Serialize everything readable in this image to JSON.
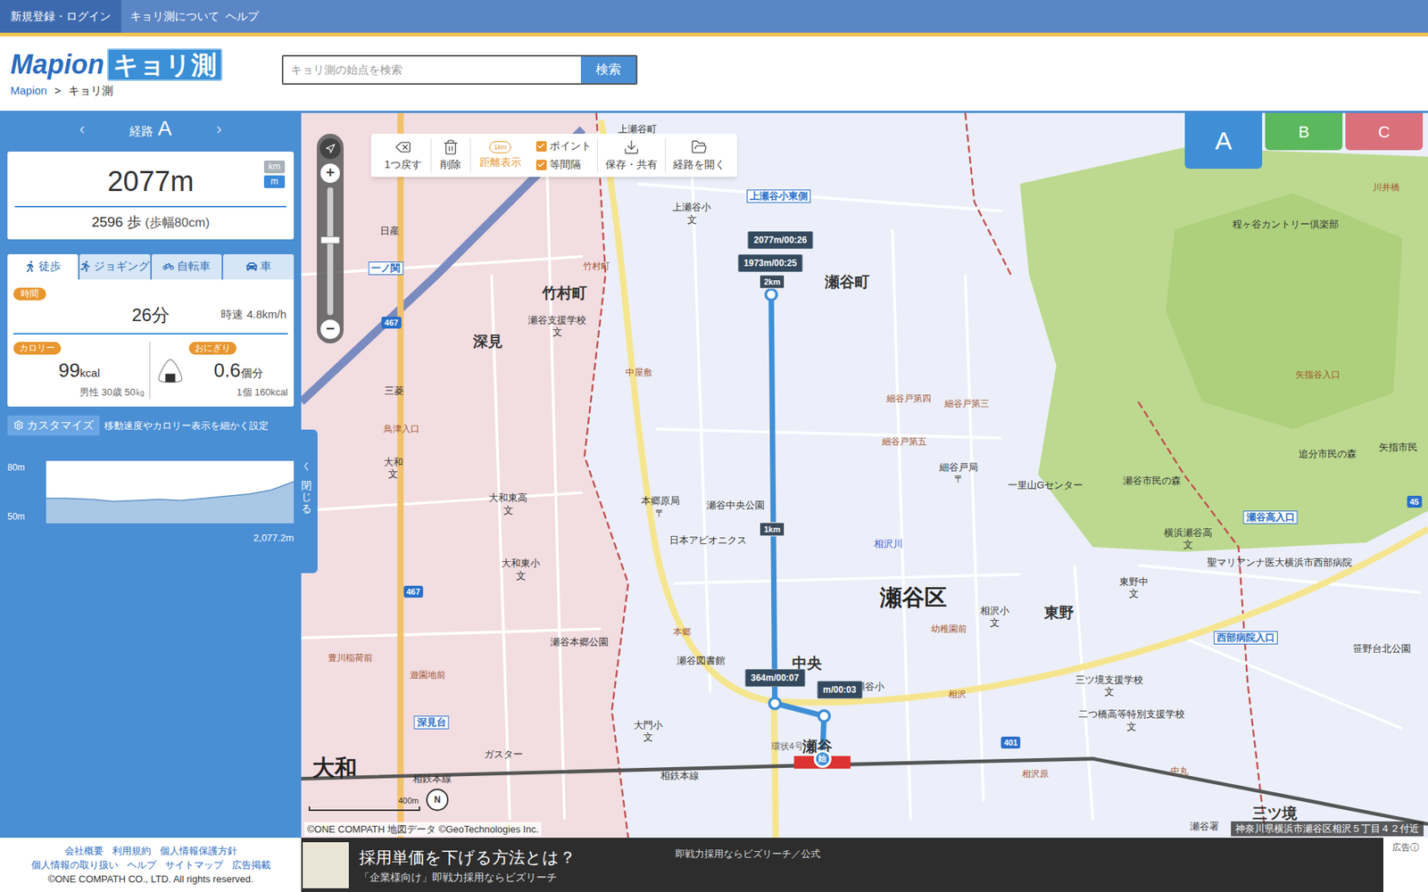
{
  "topbar": {
    "links": [
      {
        "label": "新規登録・ログイン",
        "selected": true
      },
      {
        "label": "キョリ測について",
        "selected": false
      },
      {
        "label": "ヘルプ",
        "selected": false
      }
    ]
  },
  "header": {
    "logo": {
      "brand": "Mapion",
      "product": "キョリ測"
    },
    "breadcrumb": [
      "Mapion",
      ">",
      "キョリ測"
    ],
    "search": {
      "placeholder": "キョリ測の始点を検索",
      "button": "検索"
    }
  },
  "sidebar": {
    "route": {
      "prev": "‹",
      "label": "経路",
      "name": "A",
      "next": "›"
    },
    "distance": {
      "value": "2077m",
      "units": [
        {
          "label": "km",
          "selected": false
        },
        {
          "label": "m",
          "selected": true
        }
      ],
      "steps": "2596 歩",
      "stride": "(歩幅80cm)"
    },
    "modes": [
      {
        "label": "徒歩",
        "selected": true
      },
      {
        "label": "ジョギング",
        "selected": false
      },
      {
        "label": "自転車",
        "selected": false
      },
      {
        "label": "車",
        "selected": false
      }
    ],
    "time": {
      "badge": "時間",
      "value": "26分",
      "speed": "時速 4.8km/h"
    },
    "calorie": {
      "badge": "カロリー",
      "value": "99",
      "unit": "kcal",
      "note": "男性 30歳 50㎏"
    },
    "onigiri": {
      "badge": "おにぎり",
      "value": "0.6",
      "unit": "個分",
      "note": "1個 160kcal"
    },
    "customize": {
      "button": "カスタマイズ",
      "note": "移動速度やカロリー表示を細かく設定"
    },
    "elevation": {
      "ticks": [
        "80m",
        "50m"
      ],
      "min": 50,
      "max": 80,
      "values": [
        62,
        62,
        61.5,
        60.5,
        61,
        61.5,
        61,
        62,
        63,
        64,
        66,
        70
      ],
      "distance": "2,077.2m"
    },
    "collapse": {
      "arrow": "く",
      "label": "閉じる"
    }
  },
  "map": {
    "toolbar": {
      "actions": [
        {
          "label": "1つ戻す"
        },
        {
          "label": "削除"
        }
      ],
      "distance": {
        "label": "距離表示",
        "badge": "1km",
        "active": true
      },
      "options": [
        {
          "label": "ポイント",
          "checked": true
        },
        {
          "label": "等間隔",
          "checked": true
        }
      ],
      "files": [
        {
          "label": "保存・共有"
        },
        {
          "label": "経路を開く"
        }
      ]
    },
    "routes": [
      {
        "label": "A",
        "selected": true,
        "color": "#3f8fd6"
      },
      {
        "label": "B",
        "selected": false,
        "color": "#5cb85c"
      },
      {
        "label": "C",
        "selected": false,
        "color": "#d9707a"
      }
    ],
    "zoom": {
      "in": "+",
      "out": "−",
      "level": 0.59
    },
    "markers": [
      {
        "text": "2077m/00:26",
        "kind": "label"
      },
      {
        "text": "1973m/00:25",
        "kind": "label"
      },
      {
        "text": "2km",
        "kind": "tick"
      },
      {
        "text": "1km",
        "kind": "tick"
      },
      {
        "text": "364m/00:07",
        "kind": "label"
      },
      {
        "text": "m/00:03",
        "kind": "label"
      },
      {
        "text": "始",
        "kind": "start"
      }
    ],
    "labels": [
      {
        "text": "上瀬谷町",
        "kind": "place"
      },
      {
        "text": "上瀬谷小東側",
        "kind": "bus"
      },
      {
        "text": "上瀬谷小",
        "kind": "facility",
        "symbol": "文"
      },
      {
        "text": "竹村町",
        "kind": "district"
      },
      {
        "text": "瀬谷町",
        "kind": "district"
      },
      {
        "text": "深見",
        "kind": "district"
      },
      {
        "text": "瀬谷支援学校",
        "kind": "facility",
        "symbol": "文"
      },
      {
        "text": "竹村町",
        "kind": "road"
      },
      {
        "text": "中屋敷",
        "kind": "road"
      },
      {
        "text": "一ノ関",
        "kind": "bus"
      },
      {
        "text": "日産",
        "kind": "place"
      },
      {
        "text": "三菱",
        "kind": "place"
      },
      {
        "text": "鳥津入口",
        "kind": "road"
      },
      {
        "text": "大和",
        "kind": "facility",
        "symbol": "文"
      },
      {
        "text": "大和東高",
        "kind": "facility",
        "symbol": "文"
      },
      {
        "text": "本郷原局",
        "kind": "facility",
        "symbol": "〒"
      },
      {
        "text": "瀬谷中央公園",
        "kind": "facility"
      },
      {
        "text": "日本アビオニクス",
        "kind": "facility"
      },
      {
        "text": "大和東小",
        "kind": "facility",
        "symbol": "文"
      },
      {
        "text": "細谷戸第四",
        "kind": "road"
      },
      {
        "text": "細谷戸第三",
        "kind": "road"
      },
      {
        "text": "細谷戸第五",
        "kind": "road"
      },
      {
        "text": "細谷戸局",
        "kind": "facility",
        "symbol": "〒"
      },
      {
        "text": "一里山Gセンター",
        "kind": "facility"
      },
      {
        "text": "相沢川",
        "kind": "river"
      },
      {
        "text": "瀬谷区",
        "kind": "city"
      },
      {
        "text": "相沢小",
        "kind": "facility",
        "symbol": "文"
      },
      {
        "text": "東野",
        "kind": "district"
      },
      {
        "text": "東野中",
        "kind": "facility",
        "symbol": "文"
      },
      {
        "text": "横浜瀬谷高",
        "kind": "facility",
        "symbol": "文"
      },
      {
        "text": "聖マリアンナ医大横浜市西部病院",
        "kind": "facility"
      },
      {
        "text": "瀬谷市民の森",
        "kind": "facility"
      },
      {
        "text": "追分市民の森",
        "kind": "facility"
      },
      {
        "text": "矢指市民",
        "kind": "facility"
      },
      {
        "text": "瀬谷高入口",
        "kind": "bus"
      },
      {
        "text": "程ヶ谷カントリー倶楽部",
        "kind": "facility"
      },
      {
        "text": "矢指谷入口",
        "kind": "road"
      },
      {
        "text": "西部病院入口",
        "kind": "bus"
      },
      {
        "text": "笹野台北公園",
        "kind": "facility"
      },
      {
        "text": "三ツ境支援学校",
        "kind": "facility",
        "symbol": "文"
      },
      {
        "text": "二つ橋高等特別支援学校",
        "kind": "facility",
        "symbol": "文"
      },
      {
        "text": "中央",
        "kind": "district"
      },
      {
        "text": "瀬谷小",
        "kind": "facility"
      },
      {
        "text": "幼稚園前",
        "kind": "road"
      },
      {
        "text": "瀬谷図書館",
        "kind": "facility"
      },
      {
        "text": "瀬谷本郷公園",
        "kind": "facility"
      },
      {
        "text": "大門小",
        "kind": "facility",
        "symbol": "文"
      },
      {
        "text": "深見台",
        "kind": "bus"
      },
      {
        "text": "大和",
        "kind": "city"
      },
      {
        "text": "ガスター",
        "kind": "facility"
      },
      {
        "text": "相鉄本線",
        "kind": "place"
      },
      {
        "text": "相鉄本線",
        "kind": "place"
      },
      {
        "text": "瀬谷",
        "kind": "district"
      },
      {
        "text": "環状4号",
        "kind": "vertical"
      },
      {
        "text": "三ツ境",
        "kind": "district"
      },
      {
        "text": "瀬谷署",
        "kind": "place"
      },
      {
        "text": "中丸",
        "kind": "road"
      },
      {
        "text": "相沢原",
        "kind": "road"
      },
      {
        "text": "相沢",
        "kind": "road"
      },
      {
        "text": "401",
        "kind": "route"
      },
      {
        "text": "467",
        "kind": "route"
      },
      {
        "text": "467",
        "kind": "route"
      },
      {
        "text": "45",
        "kind": "route"
      },
      {
        "text": "川井橋",
        "kind": "road"
      },
      {
        "text": "本郷",
        "kind": "road"
      },
      {
        "text": "豊川稲荷前",
        "kind": "road"
      },
      {
        "text": "遊園地前",
        "kind": "road"
      }
    ],
    "scale": "400m",
    "compass": "N",
    "copyright": "©ONE COMPATH 地図データ ©GeoTechnologies Inc.",
    "address": "神奈川県横浜市瀬谷区相沢５丁目４２付近"
  },
  "footer": {
    "links": [
      [
        "会社概要",
        "利用規約",
        "個人情報保護方針"
      ],
      [
        "個人情報の取り扱い",
        "ヘルプ",
        "サイトマップ",
        "広告掲載"
      ]
    ],
    "copyright": "©ONE COMPATH CO., LTD. All rights reserved.",
    "ad": {
      "title": "採用単価を下げる方法とは？",
      "subtitle": "「企業様向け」即戦力採用ならビズリーチ",
      "source": "即戦力採用ならビズリーチ／公式",
      "label": "広告ⓘ"
    }
  }
}
